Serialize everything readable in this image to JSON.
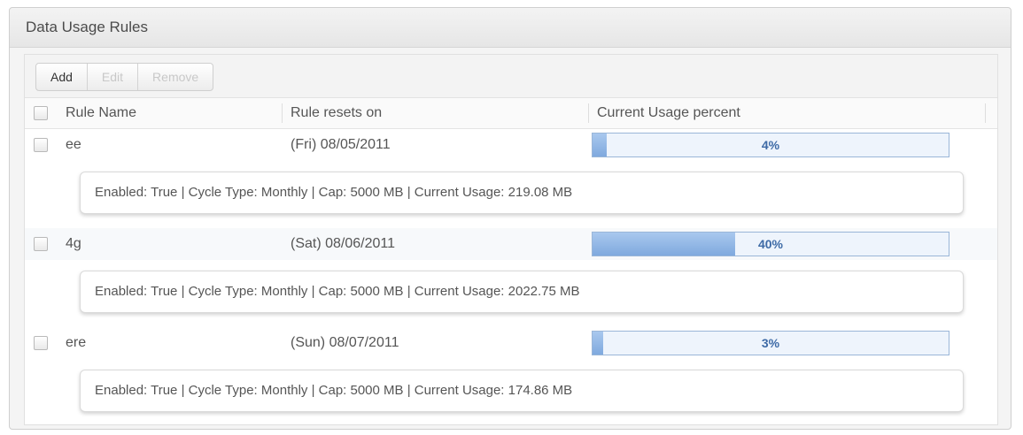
{
  "panel": {
    "title": "Data Usage Rules"
  },
  "toolbar": {
    "add_label": "Add",
    "edit_label": "Edit",
    "remove_label": "Remove"
  },
  "table": {
    "headers": {
      "rule_name": "Rule Name",
      "resets_on": "Rule resets on",
      "usage_percent": "Current Usage percent"
    },
    "rows": [
      {
        "name": "ee",
        "resets_on": "(Fri) 08/05/2011",
        "usage_percent": 4,
        "usage_label": "4%",
        "details": "Enabled: True | Cycle Type: Monthly | Cap: 5000 MB | Current Usage: 219.08 MB"
      },
      {
        "name": "4g",
        "resets_on": "(Sat) 08/06/2011",
        "usage_percent": 40,
        "usage_label": "40%",
        "details": "Enabled: True | Cycle Type: Monthly | Cap: 5000 MB | Current Usage: 2022.75 MB"
      },
      {
        "name": "ere",
        "resets_on": "(Sun) 08/07/2011",
        "usage_percent": 3,
        "usage_label": "3%",
        "details": "Enabled: True | Cycle Type: Monthly | Cap: 5000 MB | Current Usage: 174.86 MB"
      }
    ]
  }
}
